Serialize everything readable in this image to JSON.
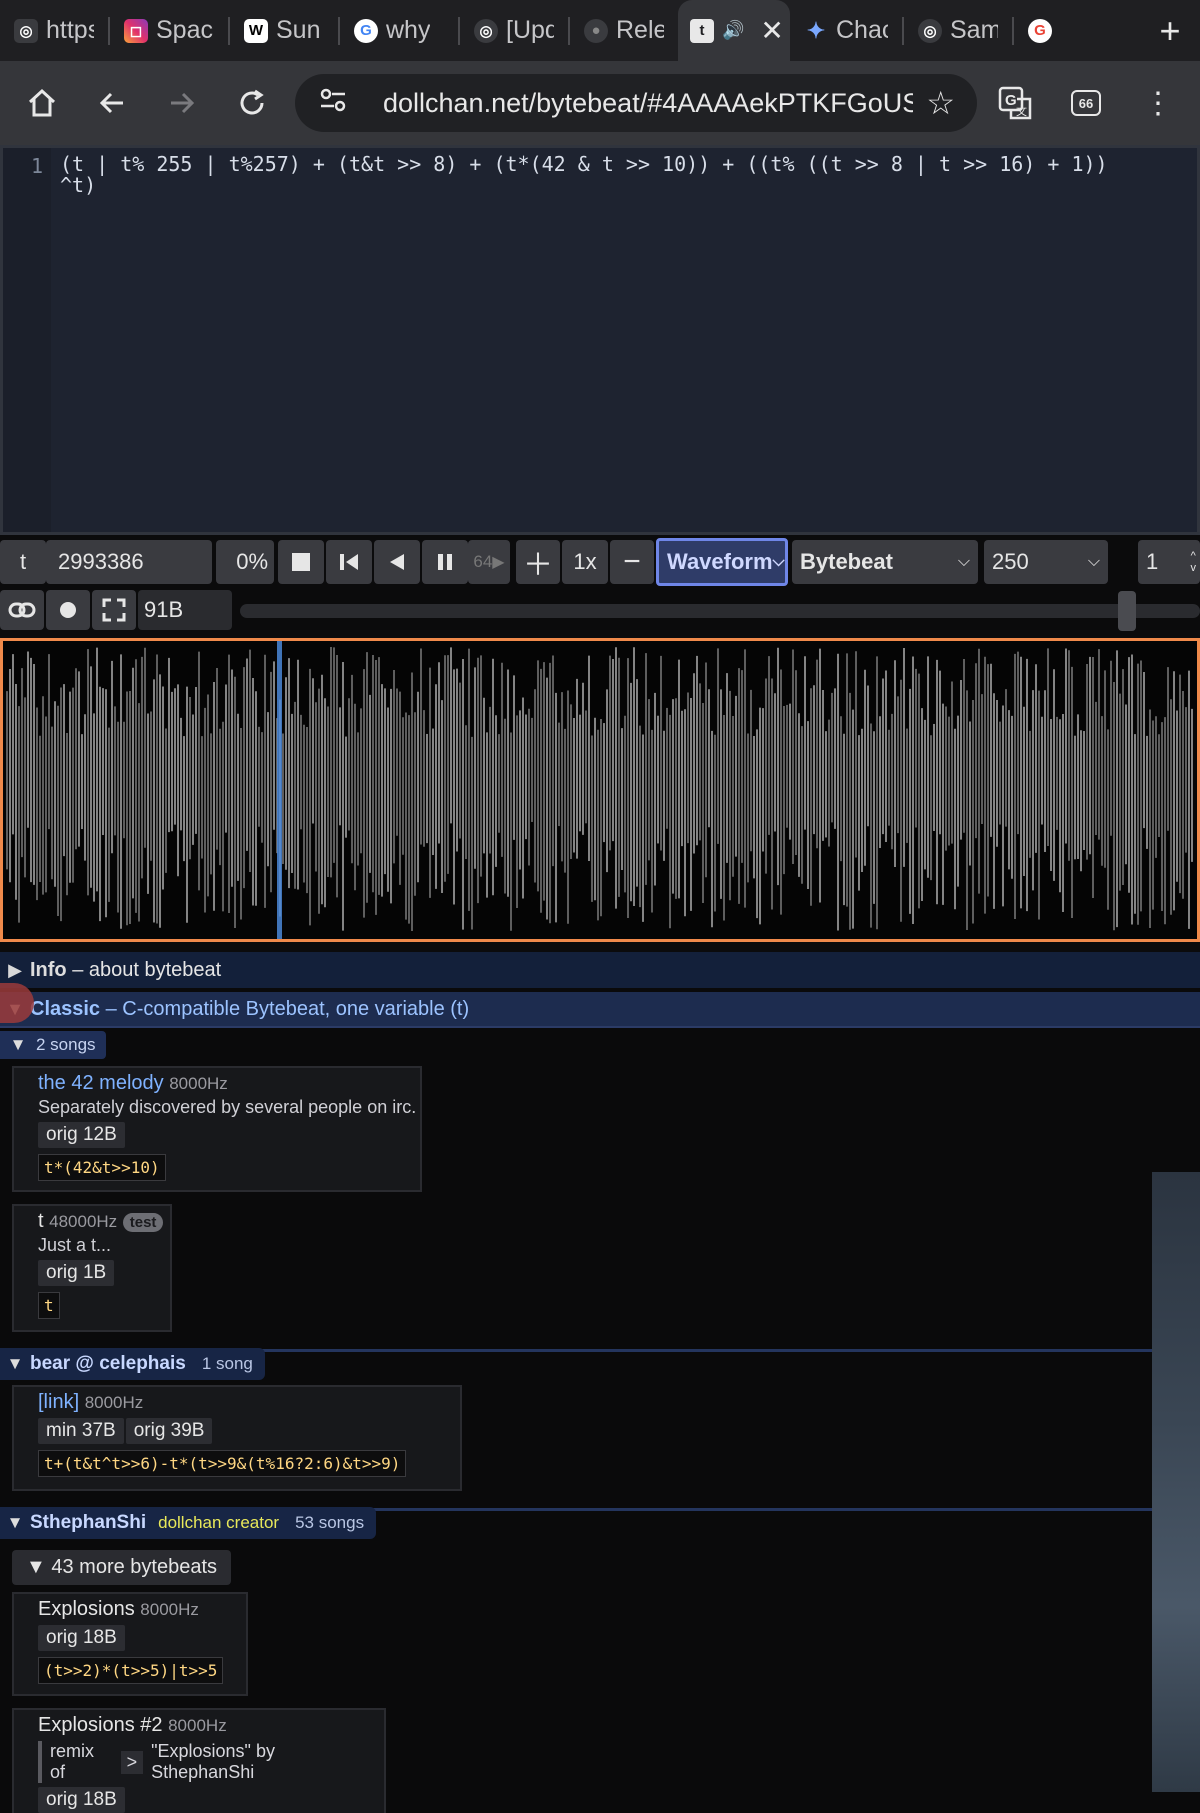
{
  "browser": {
    "tabs": [
      {
        "title": "https",
        "icon": "globe-icon"
      },
      {
        "title": "Spac",
        "icon": "instagram-icon"
      },
      {
        "title": "Sun",
        "icon": "wikipedia-icon"
      },
      {
        "title": "why",
        "icon": "google-icon"
      },
      {
        "title": "[Upd",
        "icon": "globe-icon"
      },
      {
        "title": "Rele",
        "icon": "github-icon"
      },
      {
        "title": "",
        "icon": "tumblr-icon",
        "active": true
      },
      {
        "title": "Chac",
        "icon": "gemini-icon"
      },
      {
        "title": "Sam",
        "icon": "globe-icon"
      },
      {
        "title": "",
        "icon": "google-icon"
      }
    ],
    "url": "dollchan.net/bytebeat/#4AAAAekPTKFGoUS",
    "extension_badge": "66"
  },
  "editor": {
    "line_number": "1",
    "code_line1": "(t | t% 255 | t%257) + (t&t >> 8) + (t*(42 & t >> 10)) + ((t% ((t >> 8 | t >> 16) + 1))",
    "code_line2": "^t)"
  },
  "controls": {
    "t_label": "t",
    "time_value": "2993386",
    "volume": "0%",
    "speed_step": "64",
    "playback_speed": "1x",
    "draw_mode": "Waveform",
    "mode": "Bytebeat",
    "sample_rate": "250",
    "divisor": "1",
    "size": "91B"
  },
  "library": {
    "info": {
      "title": "Info",
      "desc": "– about bytebeat"
    },
    "classic": {
      "title": "Classic",
      "desc": "– C-compatible Bytebeat, one variable (t)",
      "songs_count": "2 songs"
    },
    "songs_classic": [
      {
        "title": "the 42 melody",
        "hz": "8000Hz",
        "desc": "Separately discovered by several people on irc.",
        "tags": [
          "orig 12B"
        ],
        "code": "t*(42&t>>10)"
      },
      {
        "title": "t",
        "hz": "48000Hz",
        "badge": "test",
        "desc": "Just a t...",
        "tags": [
          "orig 1B"
        ],
        "code": "t"
      }
    ],
    "bear": {
      "author": "bear @ celephais",
      "count": "1 song"
    },
    "bear_song": {
      "title": "[link]",
      "hz": "8000Hz",
      "tags": [
        "min 37B",
        "orig 39B"
      ],
      "code": "t+(t&t^t>>6)-t*(t>>9&(t%16?2:6)&t>>9)"
    },
    "stephan": {
      "author": "SthephanShi",
      "role": "dollchan creator",
      "count": "53 songs"
    },
    "more": "43 more bytebeats",
    "songs_stephan": [
      {
        "title": "Explosions",
        "hz": "8000Hz",
        "tags": [
          "orig 18B"
        ],
        "code": "(t>>2)*(t>>5)|t>>5"
      },
      {
        "title": "Explosions #2",
        "hz": "8000Hz",
        "remix_prefix": "remix of",
        "remix_gt": ">",
        "remix_of": "\"Explosions\" by SthephanShi",
        "tags": [
          "orig 18B"
        ]
      }
    ]
  },
  "colors": {
    "accent": "#f08a4b",
    "link": "#7fb2ff",
    "code": "#ffd783",
    "waveform_sel": "#6f86e8"
  }
}
